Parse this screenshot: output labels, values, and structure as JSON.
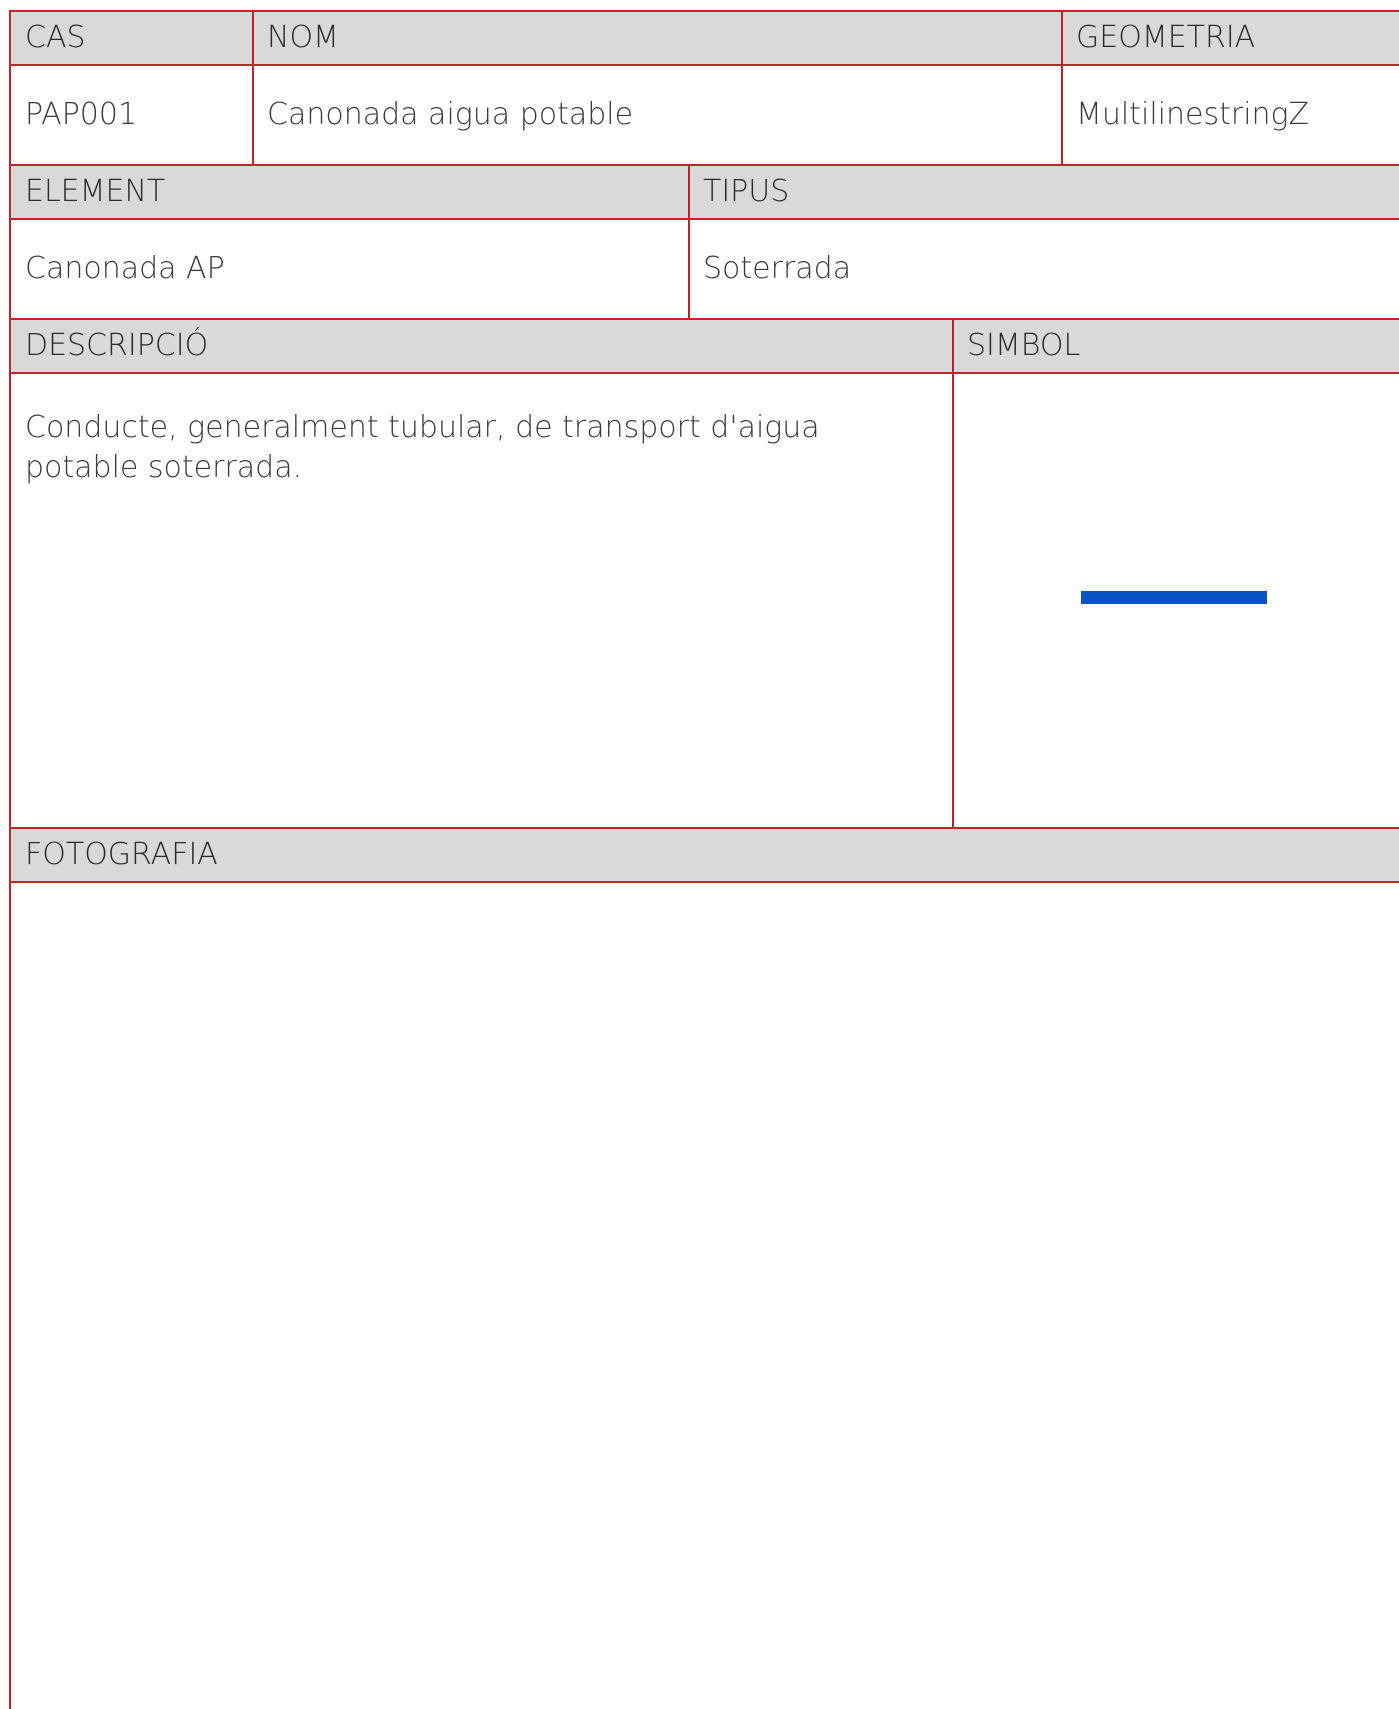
{
  "row1": {
    "headers": {
      "cas": "CAS",
      "nom": "NOM",
      "geometria": "GEOMETRIA"
    },
    "values": {
      "cas": "PAP001",
      "nom": "Canonada aigua potable",
      "geometria": "MultilinestringZ"
    }
  },
  "row2": {
    "headers": {
      "element": "ELEMENT",
      "tipus": "TIPUS"
    },
    "values": {
      "element": "Canonada AP",
      "tipus": "Soterrada"
    }
  },
  "row3": {
    "headers": {
      "descripcio": "DESCRIPCIÓ",
      "simbol": "SIMBOL"
    },
    "values": {
      "descripcio": "Conducte, generalment tubular, de transport d'aigua potable soterrada."
    },
    "symbol": {
      "type": "line",
      "color": "#0a53c4"
    }
  },
  "row4": {
    "headers": {
      "fotografia": "FOTOGRAFIA"
    }
  },
  "colors": {
    "grid": "#c0242b",
    "header_bg": "#d9d9d9"
  }
}
